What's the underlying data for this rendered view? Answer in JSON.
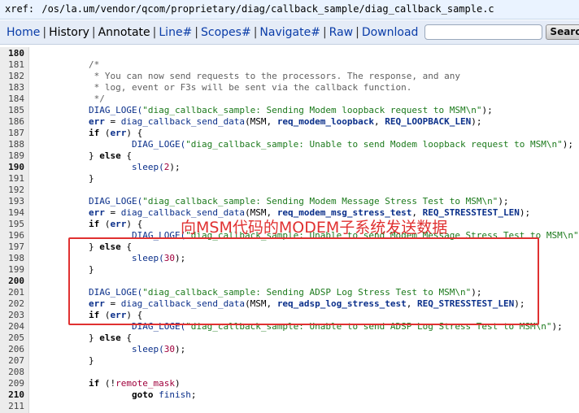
{
  "xref": {
    "label": "xref:",
    "path": "/os/la.um/vendor/qcom/proprietary/diag/callback_sample/diag_callback_sample.c"
  },
  "menu": {
    "items": [
      {
        "label": "Home",
        "style": "link"
      },
      {
        "label": "History",
        "style": "dark"
      },
      {
        "label": "Annotate",
        "style": "dark"
      },
      {
        "label": "Line#",
        "style": "link"
      },
      {
        "label": "Scopes#",
        "style": "link"
      },
      {
        "label": "Navigate#",
        "style": "link"
      },
      {
        "label": "Raw",
        "style": "link"
      },
      {
        "label": "Download",
        "style": "link"
      }
    ],
    "search_value": "",
    "search_button_label": "Search"
  },
  "annotation": {
    "text": "向MSM代码的MODEM子系统发送数据",
    "color": "#e03131"
  },
  "code": {
    "lines": [
      {
        "n": "180",
        "bold": true,
        "tokens": []
      },
      {
        "n": "181",
        "tokens": [
          {
            "t": "        /*",
            "c": "comment"
          }
        ]
      },
      {
        "n": "182",
        "tokens": [
          {
            "t": "         * You can now send requests to the processors. The response, and any",
            "c": "comment"
          }
        ]
      },
      {
        "n": "183",
        "tokens": [
          {
            "t": "         * log, event or F3s will be sent via the callback function.",
            "c": "comment"
          }
        ]
      },
      {
        "n": "184",
        "tokens": [
          {
            "t": "         */",
            "c": "comment"
          }
        ]
      },
      {
        "n": "185",
        "tokens": [
          {
            "t": "        DIAG_LOGE(",
            "c": "fn"
          },
          {
            "t": "\"diag_callback_sample: Sending Modem loopback request to MSM\\n\"",
            "c": "str"
          },
          {
            "t": ");",
            "c": "plain"
          }
        ]
      },
      {
        "n": "186",
        "tokens": [
          {
            "t": "        ",
            "c": "plain"
          },
          {
            "t": "err",
            "c": "ident"
          },
          {
            "t": " = ",
            "c": "plain"
          },
          {
            "t": "diag_callback_send_data",
            "c": "fn"
          },
          {
            "t": "(MSM, ",
            "c": "plain"
          },
          {
            "t": "req_modem_loopback",
            "c": "ident"
          },
          {
            "t": ", ",
            "c": "plain"
          },
          {
            "t": "REQ_LOOPBACK_LEN",
            "c": "ident"
          },
          {
            "t": ");",
            "c": "plain"
          }
        ]
      },
      {
        "n": "187",
        "tokens": [
          {
            "t": "        ",
            "c": "plain"
          },
          {
            "t": "if",
            "c": "kw"
          },
          {
            "t": " (",
            "c": "plain"
          },
          {
            "t": "err",
            "c": "ident"
          },
          {
            "t": ") {",
            "c": "plain"
          }
        ]
      },
      {
        "n": "188",
        "tokens": [
          {
            "t": "                DIAG_LOGE(",
            "c": "fn"
          },
          {
            "t": "\"diag_callback_sample: Unable to send Modem loopback request to MSM\\n\"",
            "c": "str"
          },
          {
            "t": ");",
            "c": "plain"
          }
        ]
      },
      {
        "n": "189",
        "tokens": [
          {
            "t": "        } ",
            "c": "plain"
          },
          {
            "t": "else",
            "c": "kw"
          },
          {
            "t": " {",
            "c": "plain"
          }
        ]
      },
      {
        "n": "190",
        "bold": true,
        "tokens": [
          {
            "t": "                sleep(",
            "c": "fn"
          },
          {
            "t": "2",
            "c": "num"
          },
          {
            "t": ");",
            "c": "plain"
          }
        ]
      },
      {
        "n": "191",
        "tokens": [
          {
            "t": "        }",
            "c": "plain"
          }
        ]
      },
      {
        "n": "192",
        "tokens": []
      },
      {
        "n": "193",
        "tokens": [
          {
            "t": "        DIAG_LOGE(",
            "c": "fn"
          },
          {
            "t": "\"diag_callback_sample: Sending Modem Message Stress Test to MSM\\n\"",
            "c": "str"
          },
          {
            "t": ");",
            "c": "plain"
          }
        ]
      },
      {
        "n": "194",
        "tokens": [
          {
            "t": "        ",
            "c": "plain"
          },
          {
            "t": "err",
            "c": "ident"
          },
          {
            "t": " = ",
            "c": "plain"
          },
          {
            "t": "diag_callback_send_data",
            "c": "fn"
          },
          {
            "t": "(MSM, ",
            "c": "plain"
          },
          {
            "t": "req_modem_msg_stress_test",
            "c": "ident"
          },
          {
            "t": ", ",
            "c": "plain"
          },
          {
            "t": "REQ_STRESSTEST_LEN",
            "c": "ident"
          },
          {
            "t": ");",
            "c": "plain"
          }
        ]
      },
      {
        "n": "195",
        "tokens": [
          {
            "t": "        ",
            "c": "plain"
          },
          {
            "t": "if",
            "c": "kw"
          },
          {
            "t": " (",
            "c": "plain"
          },
          {
            "t": "err",
            "c": "ident"
          },
          {
            "t": ") {",
            "c": "plain"
          }
        ]
      },
      {
        "n": "196",
        "tokens": [
          {
            "t": "                DIAG_LOGE(",
            "c": "fn"
          },
          {
            "t": "\"diag_callback_sample: Unable to send Modem Message Stress Test to MSM\\n\"",
            "c": "str"
          },
          {
            "t": ");",
            "c": "plain"
          }
        ]
      },
      {
        "n": "197",
        "tokens": [
          {
            "t": "        } ",
            "c": "plain"
          },
          {
            "t": "else",
            "c": "kw"
          },
          {
            "t": " {",
            "c": "plain"
          }
        ]
      },
      {
        "n": "198",
        "tokens": [
          {
            "t": "                sleep(",
            "c": "fn"
          },
          {
            "t": "30",
            "c": "num"
          },
          {
            "t": ");",
            "c": "plain"
          }
        ]
      },
      {
        "n": "199",
        "tokens": [
          {
            "t": "        }",
            "c": "plain"
          }
        ]
      },
      {
        "n": "200",
        "bold": true,
        "tokens": []
      },
      {
        "n": "201",
        "tokens": [
          {
            "t": "        DIAG_LOGE(",
            "c": "fn"
          },
          {
            "t": "\"diag_callback_sample: Sending ADSP Log Stress Test to MSM\\n\"",
            "c": "str"
          },
          {
            "t": ");",
            "c": "plain"
          }
        ]
      },
      {
        "n": "202",
        "tokens": [
          {
            "t": "        ",
            "c": "plain"
          },
          {
            "t": "err",
            "c": "ident"
          },
          {
            "t": " = ",
            "c": "plain"
          },
          {
            "t": "diag_callback_send_data",
            "c": "fn"
          },
          {
            "t": "(MSM, ",
            "c": "plain"
          },
          {
            "t": "req_adsp_log_stress_test",
            "c": "ident"
          },
          {
            "t": ", ",
            "c": "plain"
          },
          {
            "t": "REQ_STRESSTEST_LEN",
            "c": "ident"
          },
          {
            "t": ");",
            "c": "plain"
          }
        ]
      },
      {
        "n": "203",
        "tokens": [
          {
            "t": "        ",
            "c": "plain"
          },
          {
            "t": "if",
            "c": "kw"
          },
          {
            "t": " (",
            "c": "plain"
          },
          {
            "t": "err",
            "c": "ident"
          },
          {
            "t": ") {",
            "c": "plain"
          }
        ]
      },
      {
        "n": "204",
        "tokens": [
          {
            "t": "                DIAG_LOGE(",
            "c": "fn"
          },
          {
            "t": "\"diag_callback_sample: Unable to send ADSP Log Stress Test to MSM\\n\"",
            "c": "str"
          },
          {
            "t": ");",
            "c": "plain"
          }
        ]
      },
      {
        "n": "205",
        "tokens": [
          {
            "t": "        } ",
            "c": "plain"
          },
          {
            "t": "else",
            "c": "kw"
          },
          {
            "t": " {",
            "c": "plain"
          }
        ]
      },
      {
        "n": "206",
        "tokens": [
          {
            "t": "                sleep(",
            "c": "fn"
          },
          {
            "t": "30",
            "c": "num"
          },
          {
            "t": ");",
            "c": "plain"
          }
        ]
      },
      {
        "n": "207",
        "tokens": [
          {
            "t": "        }",
            "c": "plain"
          }
        ]
      },
      {
        "n": "208",
        "tokens": []
      },
      {
        "n": "209",
        "tokens": [
          {
            "t": "        ",
            "c": "plain"
          },
          {
            "t": "if",
            "c": "kw"
          },
          {
            "t": " (!",
            "c": "plain"
          },
          {
            "t": "remote_mask",
            "c": "num"
          },
          {
            "t": ")",
            "c": "plain"
          }
        ]
      },
      {
        "n": "210",
        "bold": true,
        "tokens": [
          {
            "t": "                ",
            "c": "plain"
          },
          {
            "t": "goto",
            "c": "kw"
          },
          {
            "t": " ",
            "c": "plain"
          },
          {
            "t": "finish",
            "c": "fn"
          },
          {
            "t": ";",
            "c": "plain"
          }
        ]
      },
      {
        "n": "211",
        "tokens": []
      }
    ]
  }
}
